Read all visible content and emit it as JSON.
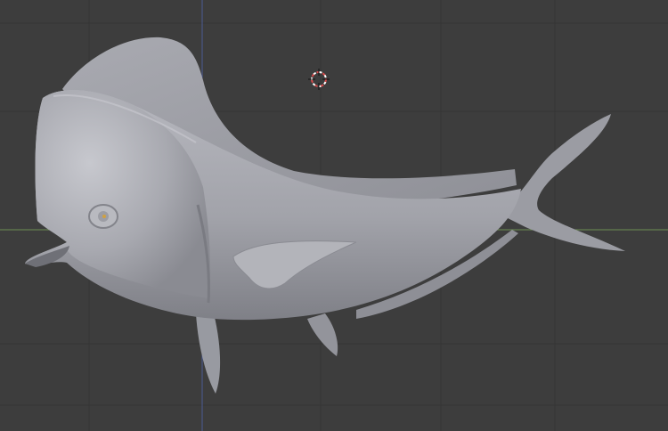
{
  "viewport": {
    "background_color": "#3d3d3d",
    "grid_color": "#353535",
    "x_axis_color": "#6d8f52",
    "y_axis_color": "#4b5a93",
    "grid_visible": true
  },
  "cursor": {
    "icon": "3d-cursor-icon",
    "ring_colors": [
      "#d94a4a",
      "#ffffff"
    ]
  },
  "model": {
    "icon": "mahi-mahi-fish-mesh",
    "body_color": "#a4a5ac",
    "fin_color": "#9a9ba2",
    "shadow_color": "#76777e",
    "highlight_color": "#c9cad0",
    "eye_color": "#d0a040"
  }
}
